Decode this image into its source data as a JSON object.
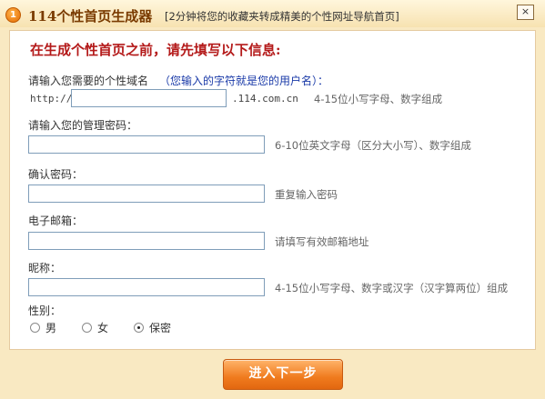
{
  "window": {
    "badge": "1",
    "title": "114个性首页生成器",
    "subtitle": "[2分钟将您的收藏夹转成精美的个性网址导航首页]",
    "close_label": "×"
  },
  "form": {
    "heading": "在生成个性首页之前，请先填写以下信息:",
    "domain": {
      "label": "请输入您需要的个性域名",
      "hint": "（您输入的字符就是您的用户名）：",
      "prefix": "http://",
      "value": "",
      "suffix": ".114.com.cn",
      "note": "4-15位小写字母、数字组成"
    },
    "password": {
      "label": "请输入您的管理密码：",
      "value": "",
      "note": "6-10位英文字母（区分大小写）、数字组成"
    },
    "confirm": {
      "label": "确认密码：",
      "value": "",
      "note": "重复输入密码"
    },
    "email": {
      "label": "电子邮箱：",
      "value": "",
      "note": "请填写有效邮箱地址"
    },
    "nickname": {
      "label": "昵称：",
      "value": "",
      "note": "4-15位小写字母、数字或汉字（汉字算两位）组成"
    },
    "gender": {
      "label": "性别：",
      "options": [
        "男",
        "女",
        "保密"
      ],
      "selected": "保密"
    }
  },
  "submit_label": "进入下一步"
}
